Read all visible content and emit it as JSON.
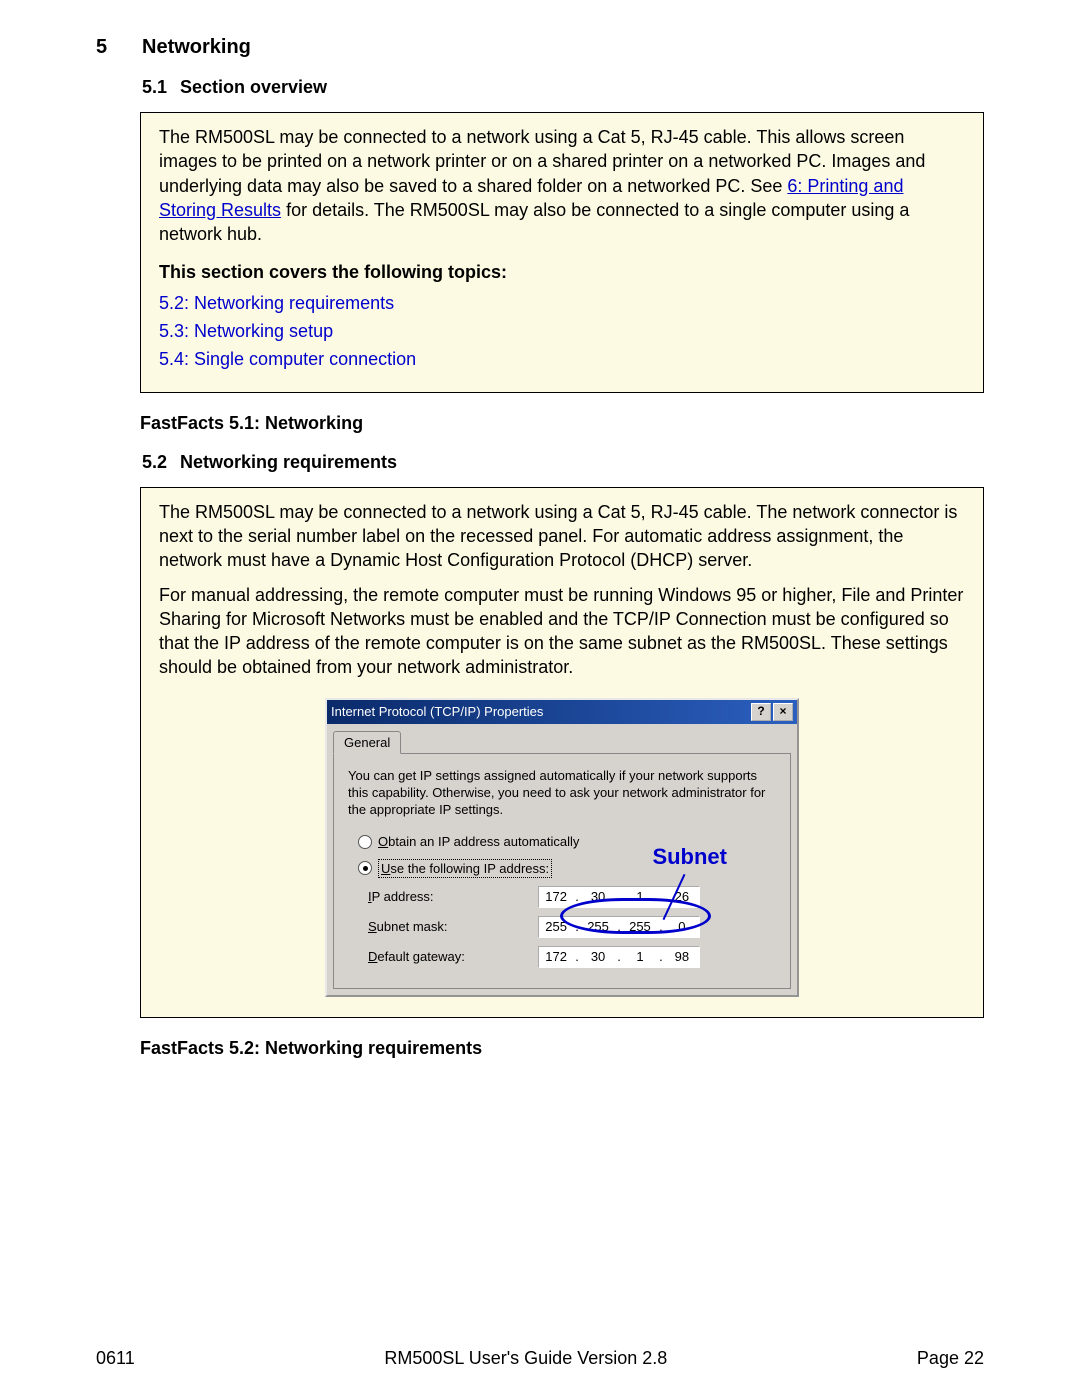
{
  "heading": {
    "num": "5",
    "title": "Networking"
  },
  "section1": {
    "num": "5.1",
    "title": "Section overview",
    "para": "The RM500SL may be connected to a network using a Cat 5, RJ-45 cable. This allows screen images to be printed on a network printer or on a shared printer on a networked PC. Images and underlying data may also be saved to a shared folder on a networked PC. See ",
    "link": "6: Printing and Storing Results",
    "para_tail": " for details. The RM500SL may also be connected to a single computer using a network hub.",
    "toc_head": "This section covers the following topics:",
    "toc": [
      "5.2: Networking requirements",
      "5.3: Networking setup",
      "5.4: Single computer connection"
    ]
  },
  "fastfacts1": "FastFacts 5.1: Networking",
  "section2": {
    "num": "5.2",
    "title": "Networking requirements",
    "p1": "The RM500SL may be connected to a network using a Cat 5, RJ-45 cable. The network connector is next to the serial number label on the recessed panel. For automatic address assignment, the network must have a Dynamic Host Configuration Protocol (DHCP) server.",
    "p2": "For manual addressing, the remote computer must be running Windows 95 or higher, File and Printer Sharing for Microsoft Networks must be enabled and the TCP/IP Connection must be configured so that the IP address of the remote computer is on the same subnet as the RM500SL. These settings should be obtained from your network administrator."
  },
  "dialog": {
    "title": "Internet Protocol (TCP/IP) Properties",
    "help": "?",
    "close": "×",
    "tab": "General",
    "desc": "You can get IP settings assigned automatically if your network supports this capability. Otherwise, you need to ask your network administrator for the appropriate IP settings.",
    "radio1_pre": "O",
    "radio1_rest": "btain an IP address automatically",
    "radio2_pre": "U",
    "radio2_rest": "se the following IP address:",
    "subnet_label": "Subnet",
    "ip_label_pre": "I",
    "ip_label_rest": "P address:",
    "subnet_label_pre": "S",
    "subnet_label_rest": "ubnet mask:",
    "gateway_label_pre": "D",
    "gateway_label_rest": "efault gateway:",
    "ip": [
      "172",
      "30",
      "1",
      "26"
    ],
    "mask": [
      "255",
      "255",
      "255",
      "0"
    ],
    "gw": [
      "172",
      "30",
      "1",
      "98"
    ]
  },
  "fastfacts2": "FastFacts 5.2: Networking requirements",
  "footer": {
    "left": "0611",
    "center": "RM500SL User's Guide Version 2.8",
    "right": "Page 22"
  }
}
